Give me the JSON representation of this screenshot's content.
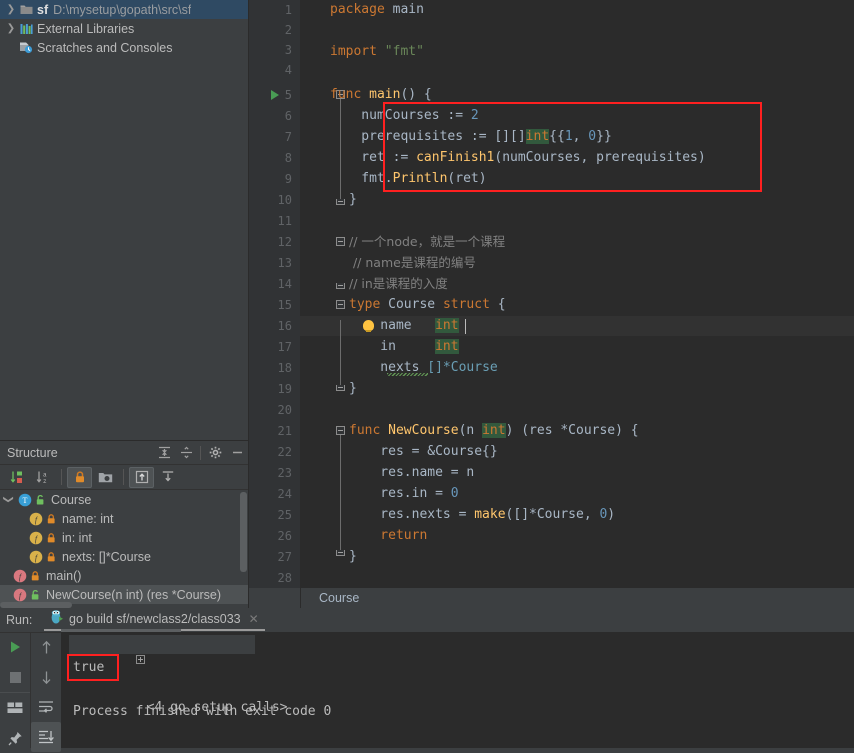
{
  "project": {
    "rows": [
      {
        "arrow": "chevron-right",
        "icon": "folder",
        "name": "sf",
        "path": "D:\\mysetup\\gopath\\src\\sf",
        "selected": true
      },
      {
        "arrow": "chevron-right",
        "icon": "libraries",
        "name": "",
        "path": "External Libraries",
        "selected": false
      },
      {
        "arrow": "none",
        "icon": "scratches",
        "name": "",
        "path": "Scratches and Consoles",
        "selected": false
      }
    ]
  },
  "structure": {
    "title": "Structure",
    "header_buttons": [
      "expand-all-icon",
      "collapse-all-icon",
      "settings-gear-icon",
      "hide-panel-icon"
    ],
    "toolbar_buttons": [
      {
        "name": "sort-by-visibility-icon",
        "active": false
      },
      {
        "name": "sort-alphabetically-icon",
        "active": false
      },
      {
        "name": "show-non-public-icon",
        "active": true
      },
      {
        "name": "group-by-file-icon",
        "active": false
      },
      {
        "name": "show-inherited-icon",
        "active": true
      },
      {
        "name": "show-imported-icon",
        "active": false
      }
    ],
    "items": [
      {
        "label": "Course",
        "kind": "type",
        "vis": "public",
        "indent": 0,
        "arrow": "chevron-down",
        "selected": false
      },
      {
        "label": "name: int",
        "kind": "field",
        "vis": "private",
        "indent": 1,
        "arrow": "none",
        "selected": false
      },
      {
        "label": "in: int",
        "kind": "field",
        "vis": "private",
        "indent": 1,
        "arrow": "none",
        "selected": false
      },
      {
        "label": "nexts: []*Course",
        "kind": "field",
        "vis": "private",
        "indent": 1,
        "arrow": "none",
        "selected": false
      },
      {
        "label": "main()",
        "kind": "func",
        "vis": "private",
        "indent": 0,
        "arrow": "none",
        "selected": false
      },
      {
        "label": "NewCourse(n int) (res *Course)",
        "kind": "func",
        "vis": "public",
        "indent": 0,
        "arrow": "none",
        "selected": true
      }
    ]
  },
  "editor": {
    "breadcrumb": "Course",
    "line_numbers": [
      "1",
      "2",
      "3",
      "4",
      "5",
      "6",
      "7",
      "8",
      "9",
      "10",
      "11",
      "12",
      "13",
      "14",
      "15",
      "16",
      "17",
      "18",
      "19",
      "20",
      "21",
      "22",
      "23",
      "24",
      "25",
      "26",
      "27",
      "28"
    ],
    "current_line": 16,
    "lines": {
      "l1_kw": "package",
      "l1_id": " main",
      "l3_kw": "import",
      "l3_str": " \"fmt\"",
      "l5_kw": "func",
      "l5_fn": " main",
      "l5_rest": "() {",
      "l6": "    numCourses := ",
      "l6_num": "2",
      "l7_a": "    prerequisites := [][]",
      "l7_int": "int",
      "l7_b": "{{",
      "l7_n1": "1",
      "l7_c": ", ",
      "l7_n2": "0",
      "l7_d": "}}",
      "l8": "    ret := ",
      "l8_fn": "canFinish1",
      "l8_rest": "(numCourses, prerequisites)",
      "l9": "    fmt.",
      "l9_fn": "Println",
      "l9_rest": "(ret)",
      "l10": "}",
      "l12_cmt": "// 一个node，就是一个课程",
      "l13_cmt": " // name是课程的编号",
      "l14_cmt": "// in是课程的入度",
      "l15_kw": "type",
      "l15_t": " Course ",
      "l15_kw2": "struct",
      "l15_rest": " {",
      "l16_name": "    name",
      "l16_int": "int",
      "l17_name": "    in",
      "l17_int": "int",
      "l18_field": "    nexts",
      "l18_rest": " []*Course",
      "l19": "}",
      "l21_kw": "func",
      "l21_fn": " NewCourse",
      "l21_a": "(n ",
      "l21_int": "int",
      "l21_b": ") (res *Course) {",
      "l22": "    res = &Course{}",
      "l23": "    res.name = n",
      "l24_a": "    res.in = ",
      "l24_n": "0",
      "l25_a": "    res.nexts = ",
      "l25_fn": "make",
      "l25_b": "([]*Course, ",
      "l25_n": "0",
      "l25_c": ")",
      "l26_kw": "    return",
      "l27": "}"
    }
  },
  "run": {
    "label": "Run:",
    "tab_name": "go build sf/newclass2/class033",
    "tab_icon": "go-gopher-icon",
    "close_icon": "close-icon",
    "toolbar_left": [
      "run-icon",
      "stop-icon",
      "layout-icon",
      "pin-icon"
    ],
    "toolbar_right": [
      "scroll-up-icon",
      "scroll-down-icon",
      "soft-wrap-icon",
      "scroll-to-end-icon"
    ],
    "console": {
      "fold_line": "<4 go setup calls>",
      "output": "true",
      "status": "Process finished with exit code 0"
    }
  },
  "colors": {
    "accent_red": "#ff2020",
    "keyword": "#cc7832",
    "string": "#6a8759",
    "number": "#6897bb",
    "function": "#ffc66d",
    "comment": "#808080",
    "identifier": "#a9b7c6",
    "editor_bg": "#2b2b2b",
    "panel_bg": "#3c3f41",
    "selection_blue": "#2f4a63"
  }
}
